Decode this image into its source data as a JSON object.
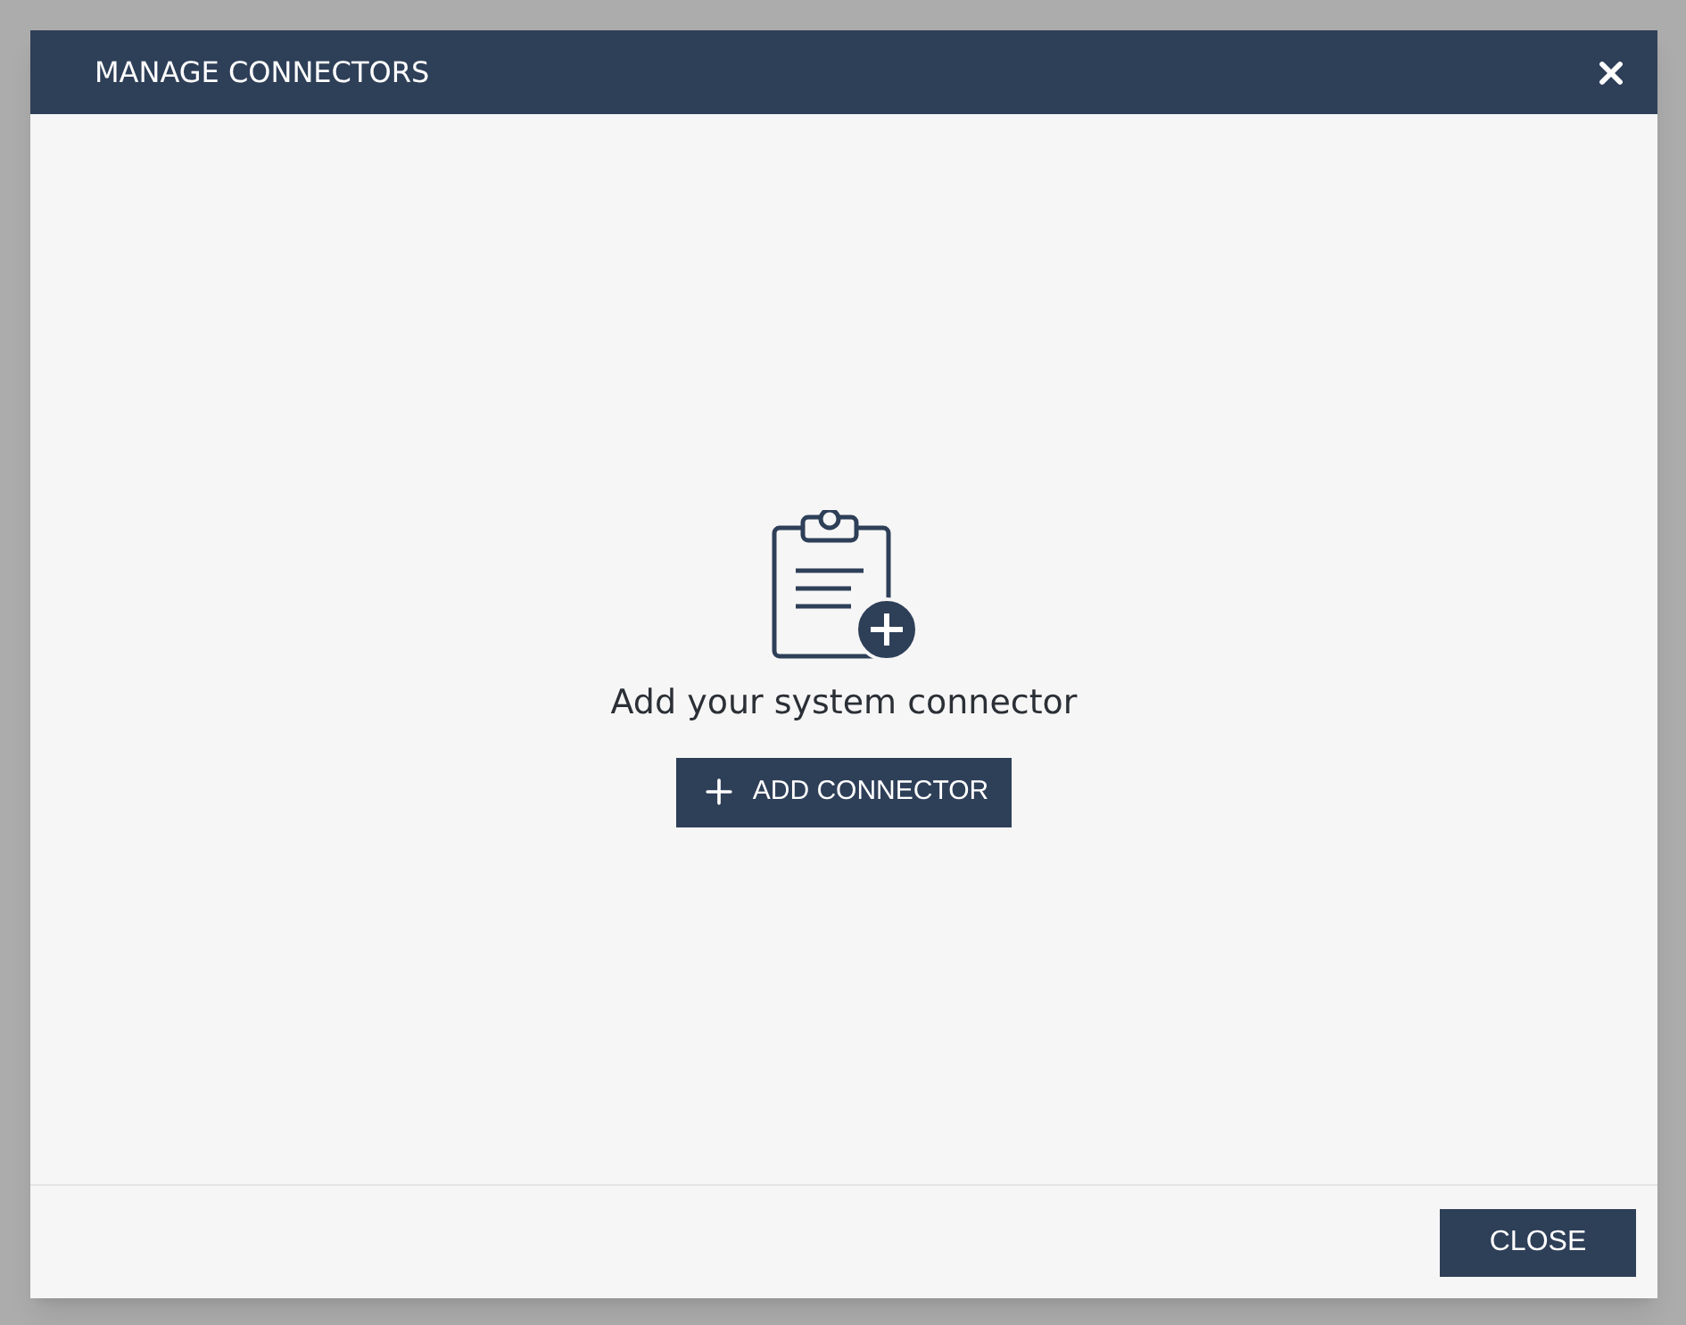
{
  "dialog": {
    "title": "MANAGE CONNECTORS"
  },
  "empty_state": {
    "message": "Add your system connector",
    "button": "ADD CONNECTOR"
  },
  "footer": {
    "button": "CLOSE"
  }
}
